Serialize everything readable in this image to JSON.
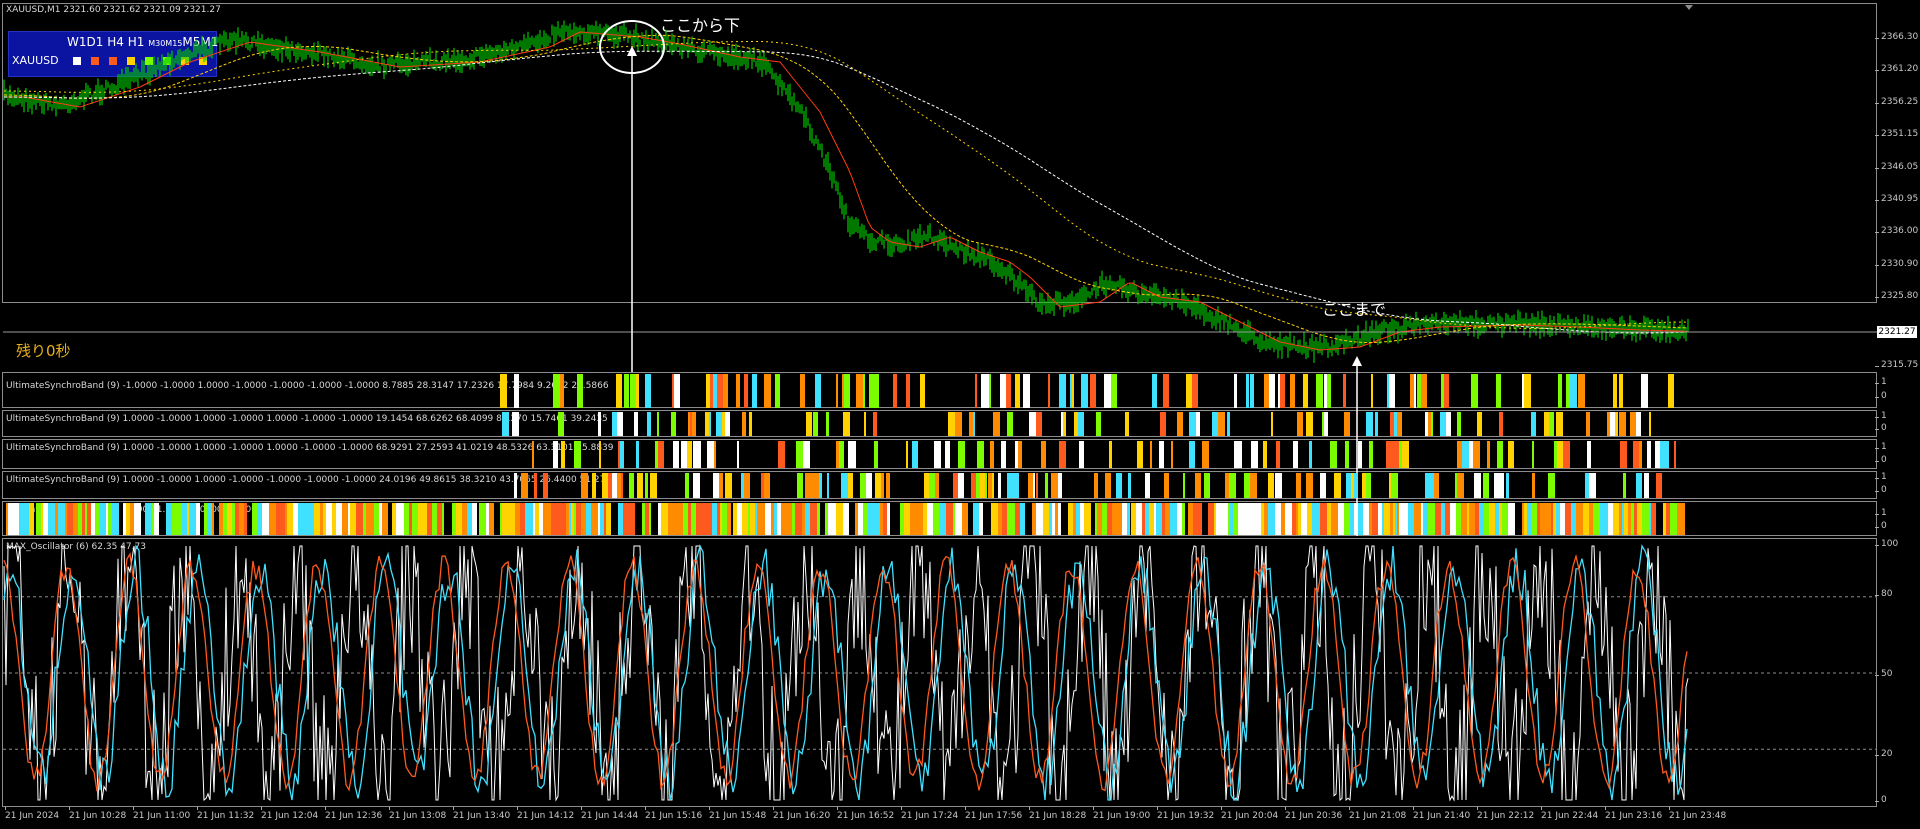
{
  "window": {
    "title": "XAUUSD,M1  2321.60 2321.62 2321.09 2321.27"
  },
  "tf_panel": {
    "labels": [
      "W1",
      "D1",
      "H4",
      "H1",
      "M30",
      "M15",
      "M5",
      "M1"
    ],
    "symbol": "XAUUSD",
    "square_colors": [
      "#ffffff",
      "#ff5a1e",
      "#ff5a1e",
      "#ffd200",
      "#7cfc00",
      "#7cfc00",
      "#ffd200",
      "#ffd200"
    ]
  },
  "annotations": {
    "top": "ここから下",
    "bottom": "ここまで",
    "remaining": "残り0秒"
  },
  "price_axis": {
    "ticks": [
      "2366.30",
      "2361.20",
      "2356.25",
      "2351.15",
      "2346.05",
      "2340.95",
      "2336.00",
      "2330.90",
      "2325.80",
      "2315.75"
    ],
    "current": "2321.27"
  },
  "indicators": [
    {
      "title": "UltimateSynchroBand (9) -1.0000 -1.0000 1.0000 -1.0000 -1.0000 -1.0000 -1.0000 8.7885 28.3147 17.2326 17.7984 9.2692 21.5866",
      "axis": [
        "1",
        "0"
      ]
    },
    {
      "title": "UltimateSynchroBand (9) 1.0000 -1.0000 1.0000 -1.0000 1.0000 -1.0000 -1.0000 19.1454 68.6262 68.4099 8.1270 15.7461 39.2435",
      "axis": [
        "1",
        "0"
      ]
    },
    {
      "title": "UltimateSynchroBand (9) 1.0000 -1.0000 1.0000 -1.0000 1.0000 -1.0000 -1.0000 68.9291 27.2593 41.0219 48.5326 63.3101 25.8839",
      "axis": [
        "1",
        "0"
      ]
    },
    {
      "title": "UltimateSynchroBand (9) 1.0000 -1.0000 1.0000 -1.0000 -1.0000 -1.0000 -1.0000 24.0196 49.8615 38.3210 43.7065 26.4400 51.2799",
      "axis": [
        "1",
        "0"
      ]
    },
    {
      "title": "UltimateSynchroBand (9) 1.0000 1.0000 1.0000 1.0000 1.0000 1.0000",
      "axis": [
        "1",
        "0"
      ]
    }
  ],
  "oscillator": {
    "title": "MAX_Oscillator (6) 62.35 47.73",
    "axis": [
      "100",
      "80",
      "50",
      "20",
      "0"
    ]
  },
  "time_axis": [
    "21 Jun 2024",
    "21 Jun 10:28",
    "21 Jun 11:00",
    "21 Jun 11:32",
    "21 Jun 12:04",
    "21 Jun 12:36",
    "21 Jun 13:08",
    "21 Jun 13:40",
    "21 Jun 14:12",
    "21 Jun 14:44",
    "21 Jun 15:16",
    "21 Jun 15:48",
    "21 Jun 16:20",
    "21 Jun 16:52",
    "21 Jun 17:24",
    "21 Jun 17:56",
    "21 Jun 18:28",
    "21 Jun 19:00",
    "21 Jun 19:32",
    "21 Jun 20:04",
    "21 Jun 20:36",
    "21 Jun 21:08",
    "21 Jun 21:40",
    "21 Jun 22:12",
    "21 Jun 22:44",
    "21 Jun 23:16",
    "21 Jun 23:48"
  ],
  "colors": {
    "candle": "#00c800",
    "ma_fast": "#ff3c14",
    "ma_mid": "#ffd200",
    "ma_slow": "#ffffff",
    "band_palette": [
      "#ffffff",
      "#ff5a1e",
      "#ffd200",
      "#7cfc00",
      "#40e0ff",
      "#ff8c00"
    ],
    "osc_main": "#ffffff",
    "osc_signal": "#40e0ff",
    "osc_slow": "#ff5a1e"
  }
}
